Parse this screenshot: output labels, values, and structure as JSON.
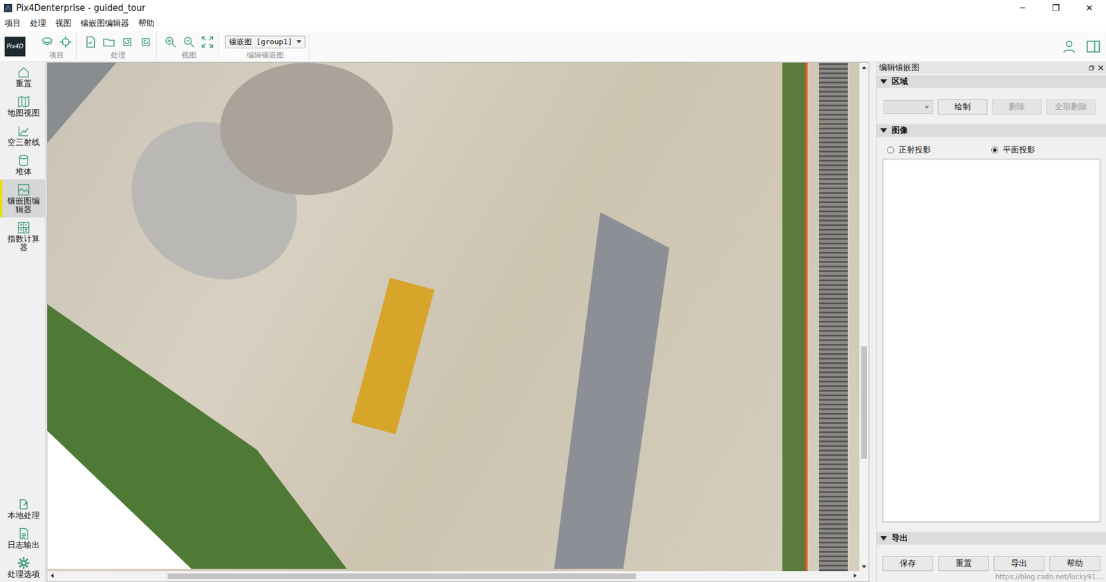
{
  "window": {
    "title": "Pix4Denterprise - guided_tour",
    "controls": [
      "─",
      "❐",
      "✕"
    ]
  },
  "menu": [
    "项目",
    "处理",
    "视图",
    "镶嵌图编辑器",
    "帮助"
  ],
  "toolbar": {
    "logo": "Pix4D",
    "groups": [
      {
        "label": "项目"
      },
      {
        "label": "处理"
      },
      {
        "label": "视图"
      },
      {
        "label": "编辑镶嵌图",
        "dropdown": "镶嵌图 [group1]"
      }
    ]
  },
  "sidebar": {
    "items": [
      {
        "label": "重置",
        "selected": false
      },
      {
        "label": "地图视图",
        "selected": false
      },
      {
        "label": "空三射线",
        "selected": false
      },
      {
        "label": "堆体",
        "selected": false
      },
      {
        "label": "镶嵌图编辑器",
        "selected": true
      },
      {
        "label": "指数计算器",
        "selected": false
      }
    ],
    "bottom_items": [
      {
        "label": "本地处理",
        "selected": false
      },
      {
        "label": "日志输出",
        "selected": false
      },
      {
        "label": "处理选项",
        "selected": false
      }
    ]
  },
  "map": {
    "h_scroll": {
      "start": 0.14,
      "size": 0.59
    },
    "v_scroll": {
      "start": 0.56,
      "size": 0.23
    }
  },
  "panel": {
    "title": "编辑镶嵌图",
    "region": {
      "title": "区域",
      "expanded": true,
      "select_value": "",
      "buttons": [
        {
          "label": "绘制",
          "disabled": false
        },
        {
          "label": "删除",
          "disabled": true
        },
        {
          "label": "全部删除",
          "disabled": true
        }
      ]
    },
    "image": {
      "title": "图像",
      "expanded": true,
      "options": [
        {
          "label": "正射投影",
          "selected": false
        },
        {
          "label": "平面投影",
          "selected": true
        }
      ]
    },
    "export": {
      "title": "导出",
      "expanded": true,
      "buttons": [
        {
          "label": "保存",
          "disabled": false
        },
        {
          "label": "重置",
          "disabled": false
        },
        {
          "label": "导出",
          "disabled": false
        },
        {
          "label": "帮助",
          "disabled": false
        }
      ]
    }
  },
  "watermark": "https://blog.csdn.net/lucky91..."
}
